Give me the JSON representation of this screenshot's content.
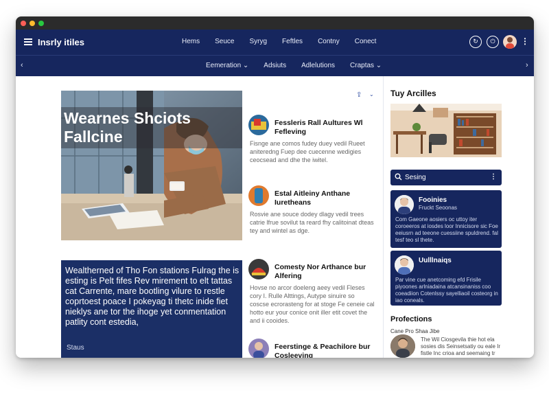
{
  "app": {
    "logo": "Insrly itiles",
    "menu": [
      "Hems",
      "Seuce",
      "Syryg",
      "Feftles",
      "Contny",
      "Conect"
    ]
  },
  "subnav": {
    "items": [
      "Eemeration ⌄",
      "Adsiuts",
      "Adlelutions",
      "Craptas ⌄"
    ],
    "left_arrow": "‹",
    "right_arrow": "›"
  },
  "hero": {
    "title": "Wearnes Shciots Fallcine"
  },
  "article2": {
    "headline": "Wealtherned of Tho Fon stations Fulrag the is esting is Pelt fifes Rev mirement to elt tattas cat Carrente, mare bootling vilure to restle coprtoest poace I pokeyag ti thetc inide fiet nieklys ane tor the ihoge yet conmentation patlity cont estedia,",
    "status": "Staus"
  },
  "feed": [
    {
      "title": "Fessleris Rall Aultures Wl Fefleving",
      "body": "Fisnge ane comos fudey duey vedil Rueet aniteredng Fuep dee cuecenne wedigies ceocsead and dhe the iwitel."
    },
    {
      "title": "Estal Aitleiny Anthane Iuretheans",
      "body": "Rosvie ane souce dodey dlagy vedil trees catrie lfrue sovilut ta reard fhy calitoinat dteas tey and wintel as dge."
    },
    {
      "title": "Comesty Nor Arthance bur Alfering",
      "body": "Hovse no arcor doeleng aeey vedil Fleses cory I. Rulle Alttings, Autype sinuire so coscse ecrorasteng for at stoge Fe ceneie cal hotto eur your conice onit iller etit covet the and ii cooides."
    },
    {
      "title": "Feerstinge & Peachilore bur Cosleeving",
      "body": ""
    }
  ],
  "sidebar": {
    "heading": "Tuy Arcilles",
    "search_label": "Sesing",
    "cards": [
      {
        "name": "Fooinies",
        "sub": "Fruckt Seoonas",
        "body": "Com Gaeone aosiers oc uttoy iter coroeeros at iosdes loor Innicisore sic Foe eeiusrn ad teeone cuessiine spuldrend. fal tesf teo sl thete."
      },
      {
        "name": "Uulllnaiqs",
        "sub": "",
        "body": "Par vine cue anetcoming efd Frisile piyoones arlniadaina atcansinaniss coo coeadiion Cotenlssy sayelliaoil costeorg in iao coneals."
      }
    ],
    "heading2": "Profections",
    "pro_meta": "Cane Pro  Shaa Jibe",
    "pro_body": "The Wil Ciosgevila thie hot ela sosies dis Seinsetsatiy ou eale Ir fistle Inc crioa and seemaing tr  sin ne tssaes i dlr seinsate."
  },
  "colors": {
    "navy": "#16265e",
    "card_navy": "#1b2f66",
    "accent_blue": "#2b4aa0"
  }
}
